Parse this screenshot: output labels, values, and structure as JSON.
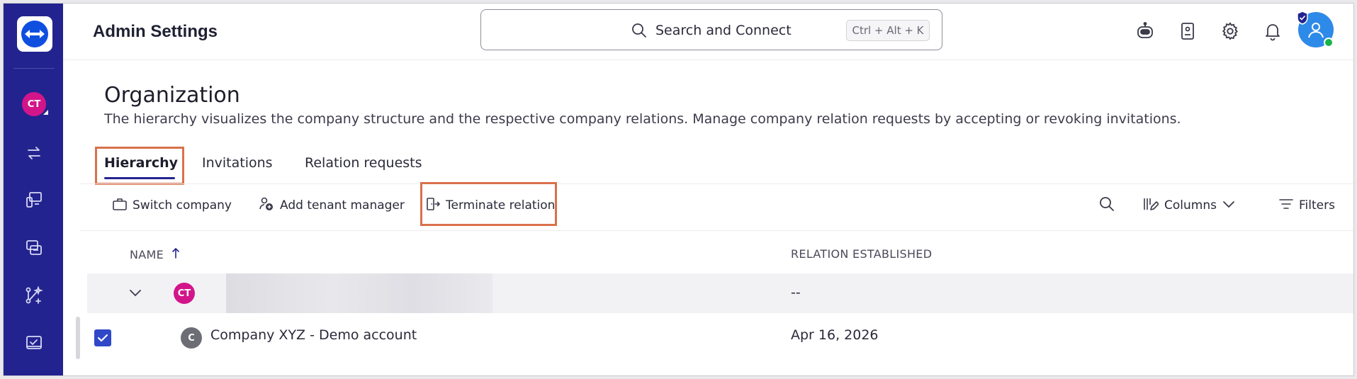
{
  "app": {
    "title": "Admin Settings"
  },
  "nav": {
    "avatar_initials": "CT",
    "icons": [
      "transfer-icon",
      "remote-device-icon",
      "sessions-icon",
      "workflow-icon",
      "tasks-icon"
    ]
  },
  "search": {
    "placeholder": "Search and Connect",
    "shortcut": "Ctrl + Alt + K"
  },
  "header_icons": [
    "assistant-robot-icon",
    "contacts-icon",
    "gear-icon",
    "bell-icon",
    "user-avatar-icon"
  ],
  "page": {
    "title": "Organization",
    "description": "The hierarchy visualizes the company structure and the respective company relations. Manage company relation requests by accepting or revoking invitations."
  },
  "tabs": [
    {
      "label": "Hierarchy",
      "active": true
    },
    {
      "label": "Invitations",
      "active": false
    },
    {
      "label": "Relation requests",
      "active": false
    }
  ],
  "toolbar": {
    "switch_company": "Switch company",
    "add_tenant_manager": "Add tenant manager",
    "terminate_relation": "Terminate relation",
    "columns": "Columns",
    "filters": "Filters"
  },
  "table": {
    "columns": [
      "NAME",
      "RELATION ESTABLISHED"
    ],
    "rows": [
      {
        "initials": "CT",
        "name": "",
        "established": "--",
        "avatar_color": "#d3158a",
        "expanded": true
      },
      {
        "initials": "C",
        "name": "Company XYZ - Demo account",
        "established": "Apr 16, 2026",
        "avatar_color": "#6d6d75",
        "checked": true
      }
    ]
  },
  "colors": {
    "nav_bg": "#23238f",
    "accent": "#2f48c8",
    "highlight": "#d9714c",
    "online": "#19b34a"
  }
}
